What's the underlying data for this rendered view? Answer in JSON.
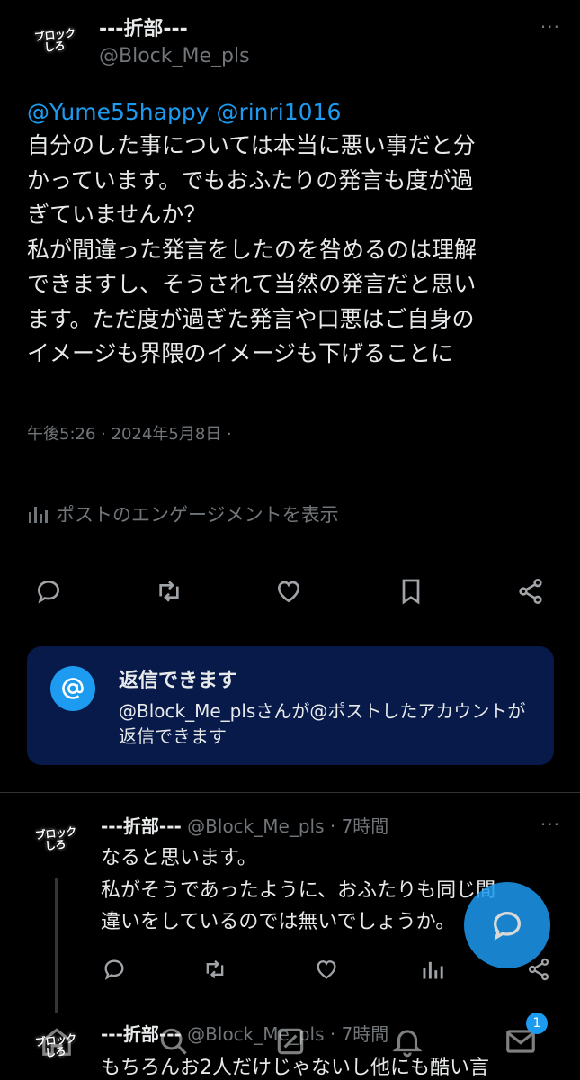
{
  "main_tweet": {
    "avatar_text_line1": "ブロック",
    "avatar_text_line2": "しろ",
    "display_name": "---折部---",
    "handle": "@Block_Me_pls",
    "more": "···",
    "mention1": "@Yume55happy",
    "mention2": "@rinri1016",
    "body": "自分のした事については本当に悪い事だと分\nかっています。でもおふたりの発言も度が過\nぎていませんか？\n私が間違った発言をしたのを咎めるのは理解\nできますし、そうされて当然の発言だと思い\nます。ただ度が過ぎた発言や口悪はご自身の\nイメージも界隈のイメージも下げることに",
    "meta": "午後5:26 · 2024年5月8日 ·",
    "engagement_label": "ポストのエンゲージメントを表示"
  },
  "actions": {
    "reply_icon": "reply-icon",
    "retweet_icon": "retweet-icon",
    "like_icon": "like-icon",
    "bookmark_icon": "bookmark-icon",
    "share_icon": "share-icon"
  },
  "reply_notice": {
    "title": "返信できます",
    "description": "@Block_Me_plsさんが@ポストしたアカウントが返信できます"
  },
  "reply_tweet": {
    "display_name": "---折部---",
    "handle": "@Block_Me_pls",
    "separator": "·",
    "time": "7時間",
    "more": "···",
    "body": "なると思います。\n私がそうであったように、おふたりも同じ間\n違いをしているのでは無いでしょうか。"
  },
  "next_tweet": {
    "display_name": "---折部---",
    "handle": "@Block_Me_pls",
    "separator": "·",
    "time": "7時間",
    "body": "もちろんお2人だけじゃないし他にも酷い言"
  },
  "bottom_nav": {
    "notification_badge": "1"
  },
  "colors": {
    "background": "#000000",
    "accent": "#1d9bf0",
    "muted": "#71767b",
    "notice_bg": "#081a4a"
  }
}
